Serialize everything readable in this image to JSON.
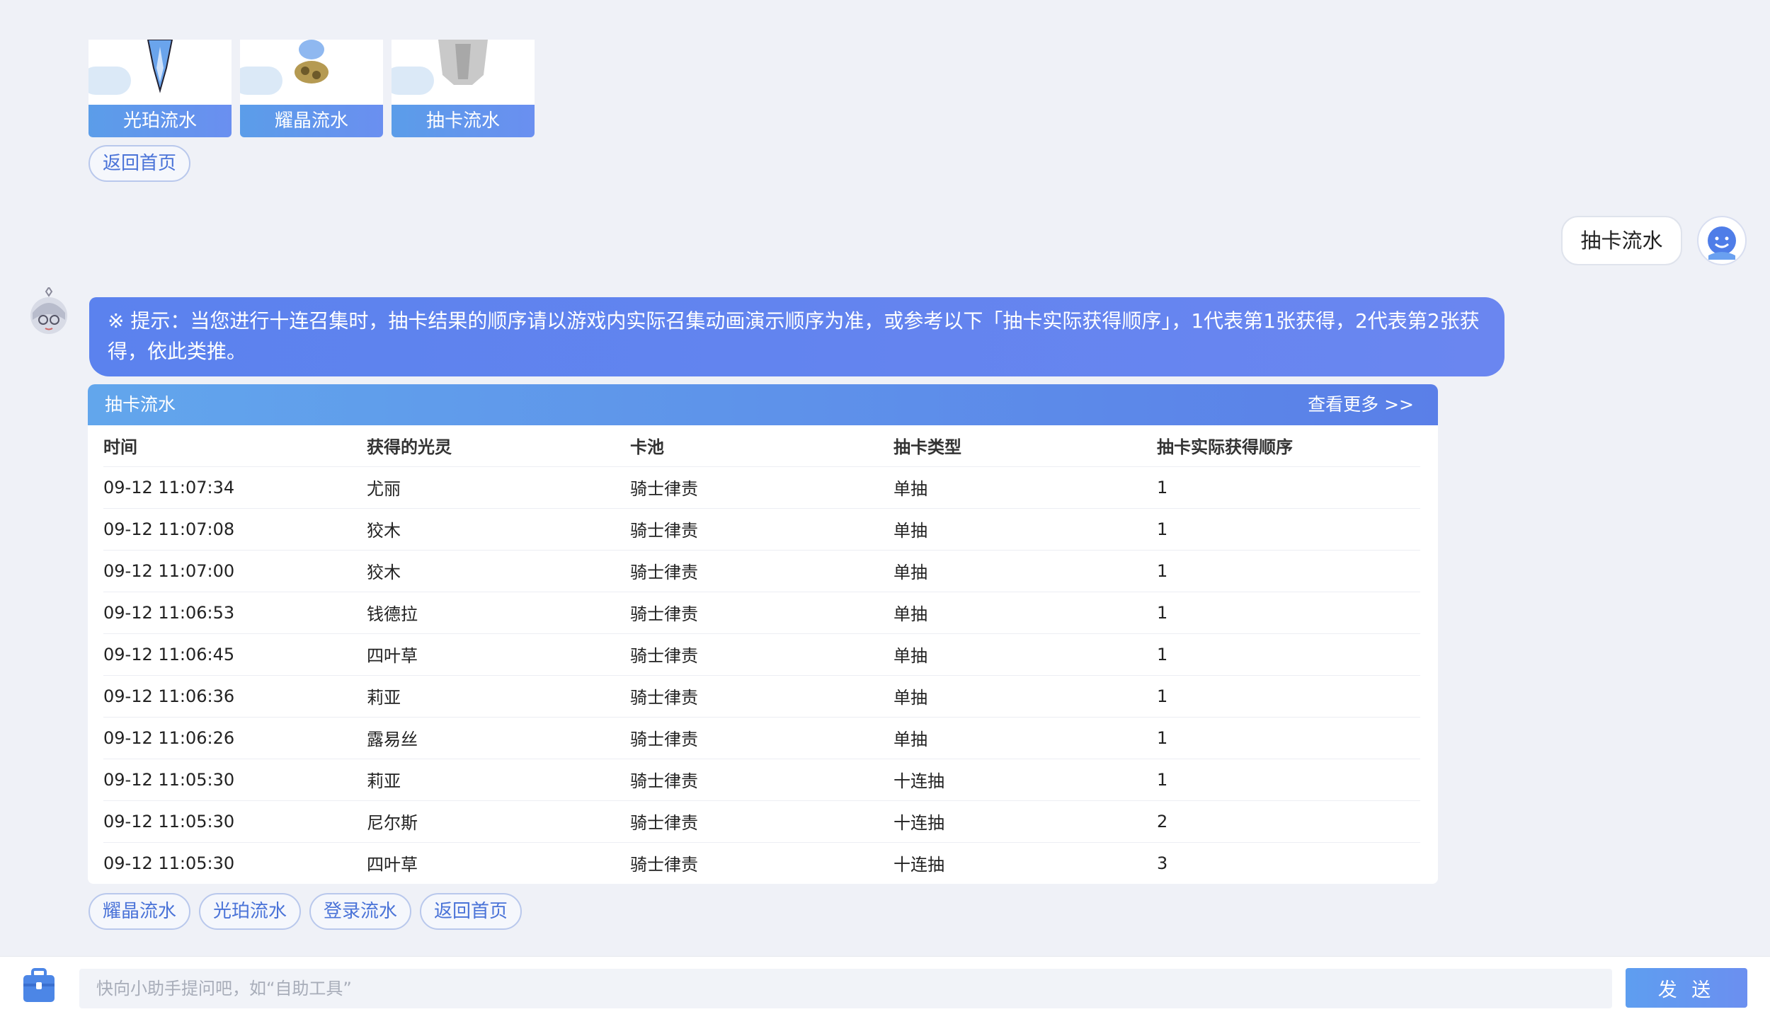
{
  "top_cards": [
    {
      "label": "光珀流水"
    },
    {
      "label": "耀晶流水"
    },
    {
      "label": "抽卡流水"
    }
  ],
  "home_top_label": "返回首页",
  "user_message": "抽卡流水",
  "tip_text": "※ 提示：当您进行十连召集时，抽卡结果的顺序请以游戏内实际召集动画演示顺序为准，或参考以下「抽卡实际获得顺序」，1代表第1张获得，2代表第2张获得，依此类推。",
  "table": {
    "title": "抽卡流水",
    "more_label": "查看更多 >>",
    "headers": [
      "时间",
      "获得的光灵",
      "卡池",
      "抽卡类型",
      "抽卡实际获得顺序"
    ],
    "rows": [
      [
        "09-12 11:07:34",
        "尤丽",
        "骑士律责",
        "单抽",
        "1"
      ],
      [
        "09-12 11:07:08",
        "狡木",
        "骑士律责",
        "单抽",
        "1"
      ],
      [
        "09-12 11:07:00",
        "狡木",
        "骑士律责",
        "单抽",
        "1"
      ],
      [
        "09-12 11:06:53",
        "钱德拉",
        "骑士律责",
        "单抽",
        "1"
      ],
      [
        "09-12 11:06:45",
        "四叶草",
        "骑士律责",
        "单抽",
        "1"
      ],
      [
        "09-12 11:06:36",
        "莉亚",
        "骑士律责",
        "单抽",
        "1"
      ],
      [
        "09-12 11:06:26",
        "露易丝",
        "骑士律责",
        "单抽",
        "1"
      ],
      [
        "09-12 11:05:30",
        "莉亚",
        "骑士律责",
        "十连抽",
        "1"
      ],
      [
        "09-12 11:05:30",
        "尼尔斯",
        "骑士律责",
        "十连抽",
        "2"
      ],
      [
        "09-12 11:05:30",
        "四叶草",
        "骑士律责",
        "十连抽",
        "3"
      ]
    ]
  },
  "quick_actions": [
    "耀晶流水",
    "光珀流水",
    "登录流水",
    "返回首页"
  ],
  "input": {
    "placeholder": "快向小助手提问吧，如“自助工具”",
    "value": ""
  },
  "send_label": "发 送",
  "colors": {
    "accent": "#5b82ee",
    "page_bg": "#eff1f7",
    "pill_text": "#4a73d8"
  }
}
